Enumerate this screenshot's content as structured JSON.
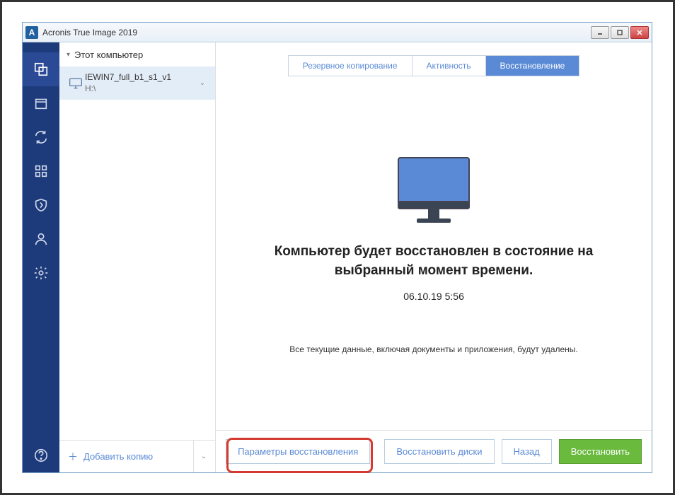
{
  "window": {
    "title": "Acronis True Image 2019"
  },
  "side": {
    "header": "Этот компьютер",
    "item": {
      "name": "IEWIN7_full_b1_s1_v1",
      "path": "H:\\"
    },
    "add_label": "Добавить копию"
  },
  "tabs": {
    "backup": "Резервное копирование",
    "activity": "Активность",
    "recovery": "Восстановление"
  },
  "main": {
    "headline": "Компьютер будет восстановлен в состояние на выбранный момент времени.",
    "timestamp": "06.10.19 5:56",
    "warning": "Все текущие данные, включая документы и приложения, будут удалены."
  },
  "footer": {
    "params": "Параметры восстановления",
    "recover_disks": "Восстановить диски",
    "back": "Назад",
    "recover": "Восстановить"
  }
}
